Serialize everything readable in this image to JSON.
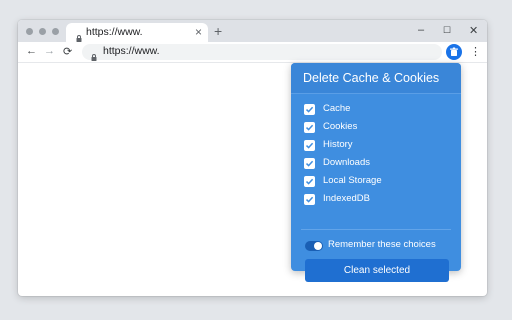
{
  "browser": {
    "tab": {
      "title": "https://www.",
      "close_glyph": "×"
    },
    "new_tab_glyph": "+",
    "window_controls": {
      "minimize": "–",
      "maximize": "☐",
      "close": "✕"
    },
    "nav": {
      "back": "←",
      "forward": "→",
      "reload": "⟳"
    },
    "address": {
      "value": "https://www."
    },
    "menu_glyph": "⋮"
  },
  "extension_popup": {
    "title": "Delete Cache & Cookies",
    "options": [
      {
        "label": "Cache",
        "checked": true
      },
      {
        "label": "Cookies",
        "checked": true
      },
      {
        "label": "History",
        "checked": true
      },
      {
        "label": "Downloads",
        "checked": true
      },
      {
        "label": "Local Storage",
        "checked": true
      },
      {
        "label": "IndexedDB",
        "checked": true
      }
    ],
    "remember": {
      "label": "Remember these choices",
      "on": true
    },
    "action_button": "Clean selected"
  },
  "colors": {
    "popup_bg": "#3f8ee0",
    "accent": "#1a73e8",
    "button": "#1f6fd1"
  }
}
